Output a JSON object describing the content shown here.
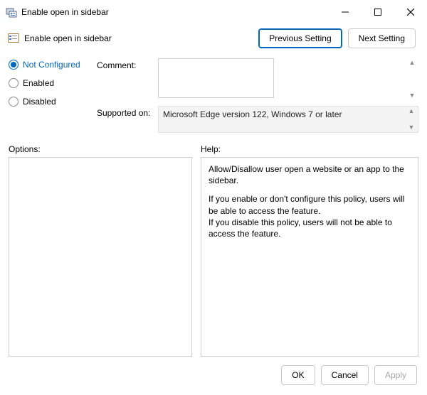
{
  "window": {
    "title": "Enable open in sidebar"
  },
  "subheader": {
    "title": "Enable open in sidebar",
    "prev_label": "Previous Setting",
    "next_label": "Next Setting"
  },
  "state_radios": {
    "not_configured": "Not Configured",
    "enabled": "Enabled",
    "disabled": "Disabled",
    "selected": "not_configured"
  },
  "fields": {
    "comment_label": "Comment:",
    "comment_value": "",
    "supported_label": "Supported on:",
    "supported_value": "Microsoft Edge version 122, Windows 7 or later"
  },
  "panels": {
    "options_label": "Options:",
    "help_label": "Help:"
  },
  "help": {
    "p1": "Allow/Disallow user open a website or an app to the sidebar.",
    "p2": "If you enable or don't configure this policy, users will be able to access the feature.",
    "p3": "If you disable this policy, users will not be able to access the feature."
  },
  "footer": {
    "ok": "OK",
    "cancel": "Cancel",
    "apply": "Apply"
  }
}
